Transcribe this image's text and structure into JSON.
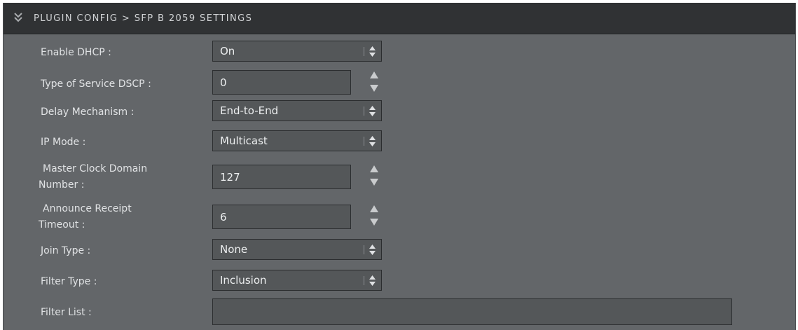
{
  "header": {
    "title": "PLUGIN CONFIG > SFP B 2059 SETTINGS",
    "collapse_icon": "double-chevron-down-icon"
  },
  "fields": {
    "enable_dhcp": {
      "label": "Enable DHCP :",
      "value": "On"
    },
    "tos_dscp": {
      "label": "Type of Service DSCP :",
      "value": "0"
    },
    "delay_mechanism": {
      "label": "Delay Mechanism :",
      "value": "End-to-End"
    },
    "ip_mode": {
      "label": "IP Mode :",
      "value": "Multicast"
    },
    "master_clock_domain": {
      "label_line1": "Master Clock Domain",
      "label_line2": "Number :",
      "value": "127"
    },
    "announce_receipt_timeout": {
      "label_line1": "Announce Receipt",
      "label_line2": "Timeout :",
      "value": "6"
    },
    "join_type": {
      "label": "Join Type :",
      "value": "None"
    },
    "filter_type": {
      "label": "Filter Type :",
      "value": "Inclusion"
    },
    "filter_list": {
      "label": "Filter List :",
      "value": ""
    }
  },
  "colors": {
    "panel_bg": "#636669",
    "header_bg": "#303234",
    "input_bg": "#545759",
    "text": "#e0e2e4"
  }
}
